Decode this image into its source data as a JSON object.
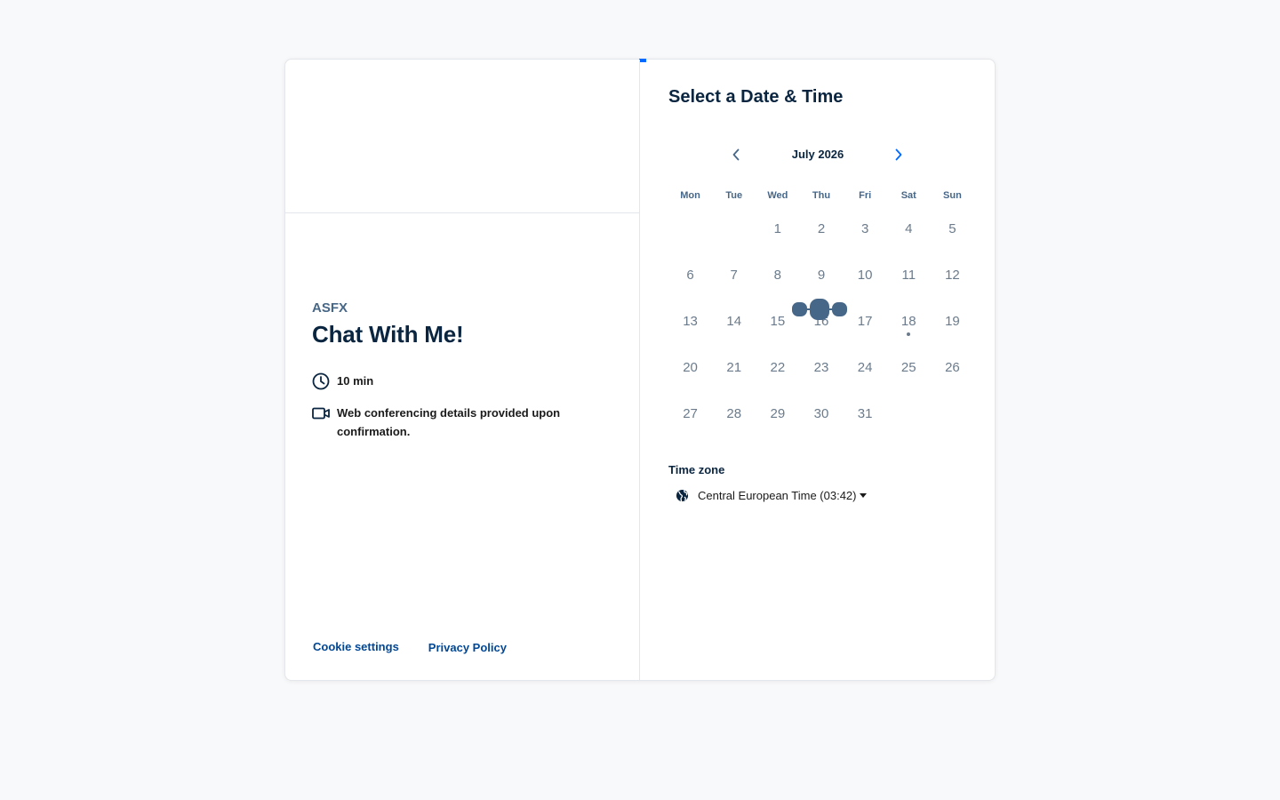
{
  "event": {
    "organizer": "ASFX",
    "title": "Chat With Me!",
    "duration": "10 min",
    "conferencing": "Web conferencing details provided upon confirmation.",
    "duration_icon": "clock-icon",
    "conferencing_icon": "video-camera-icon"
  },
  "footer": {
    "cookie_settings": "Cookie settings",
    "privacy_policy": "Privacy Policy"
  },
  "picker": {
    "title": "Select a Date & Time",
    "month": "July 2026",
    "prev_icon": "chevron-left-icon",
    "next_icon": "chevron-right-icon",
    "weekdays": [
      "Mon",
      "Tue",
      "Wed",
      "Thu",
      "Fri",
      "Sat",
      "Sun"
    ],
    "weeks": [
      [
        "",
        "",
        "1",
        "2",
        "3",
        "4",
        "5"
      ],
      [
        "6",
        "7",
        "8",
        "9",
        "10",
        "11",
        "12"
      ],
      [
        "13",
        "14",
        "15",
        "16",
        "17",
        "18",
        "19"
      ],
      [
        "20",
        "21",
        "22",
        "23",
        "24",
        "25",
        "26"
      ],
      [
        "27",
        "28",
        "29",
        "30",
        "31",
        "",
        ""
      ]
    ],
    "today": "18",
    "loading_indicator": true
  },
  "timezone": {
    "label": "Time zone",
    "value": "Central European Time (03:42)",
    "icon": "globe-icon"
  },
  "colors": {
    "accent": "#0069ff",
    "link": "#004796",
    "loader": "#476788"
  }
}
